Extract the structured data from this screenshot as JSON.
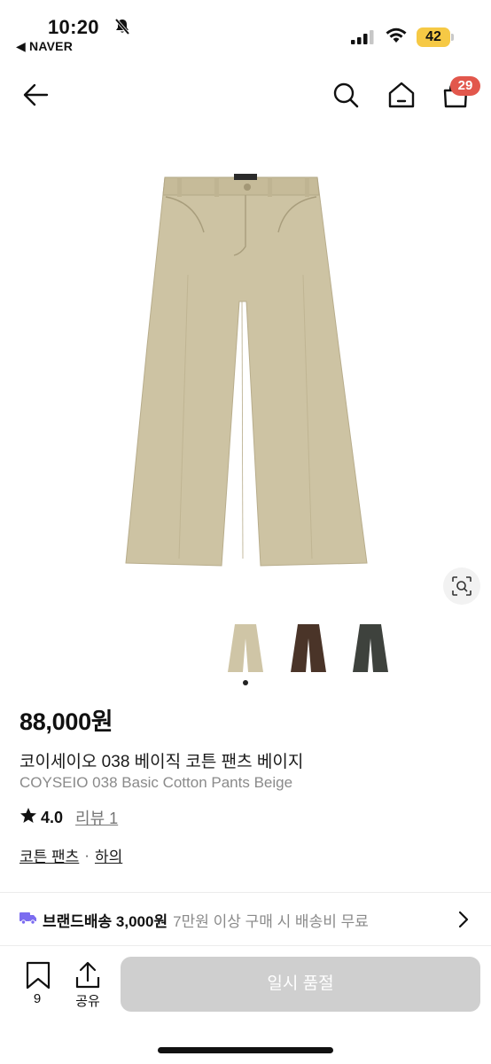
{
  "status_bar": {
    "time": "10:20",
    "back_app": "◀ NAVER",
    "battery": "42"
  },
  "nav": {
    "cart_count": "29",
    "icons": [
      "back-arrow-icon",
      "search-icon",
      "home-icon",
      "cart-icon"
    ]
  },
  "product": {
    "price": "88,000원",
    "title_ko": "코이세이오 038 베이직 코튼 팬츠 베이지",
    "title_en": "COYSEIO 038 Basic Cotton Pants Beige",
    "rating": "4.0",
    "review_label": "리뷰 1",
    "categories": [
      "코튼 팬츠",
      "하의"
    ],
    "category_sep": "·",
    "image_color": "#cdc3a3",
    "thumbnail_colors": [
      "#cfc5a6",
      "#4a3428",
      "#3e423d"
    ]
  },
  "shipping": {
    "label": "브랜드배송 3,000원",
    "note": "7만원 이상 구매 시 배송비 무료",
    "icon": "truck-icon"
  },
  "bottom_bar": {
    "wish_count": "9",
    "share_label": "공유",
    "primary_button": "일시 품절"
  },
  "colors": {
    "badge": "#e2574c",
    "battery": "#f6c945",
    "disabled_button": "#cfcfcf",
    "accent_truck": "#7b6cf0"
  }
}
